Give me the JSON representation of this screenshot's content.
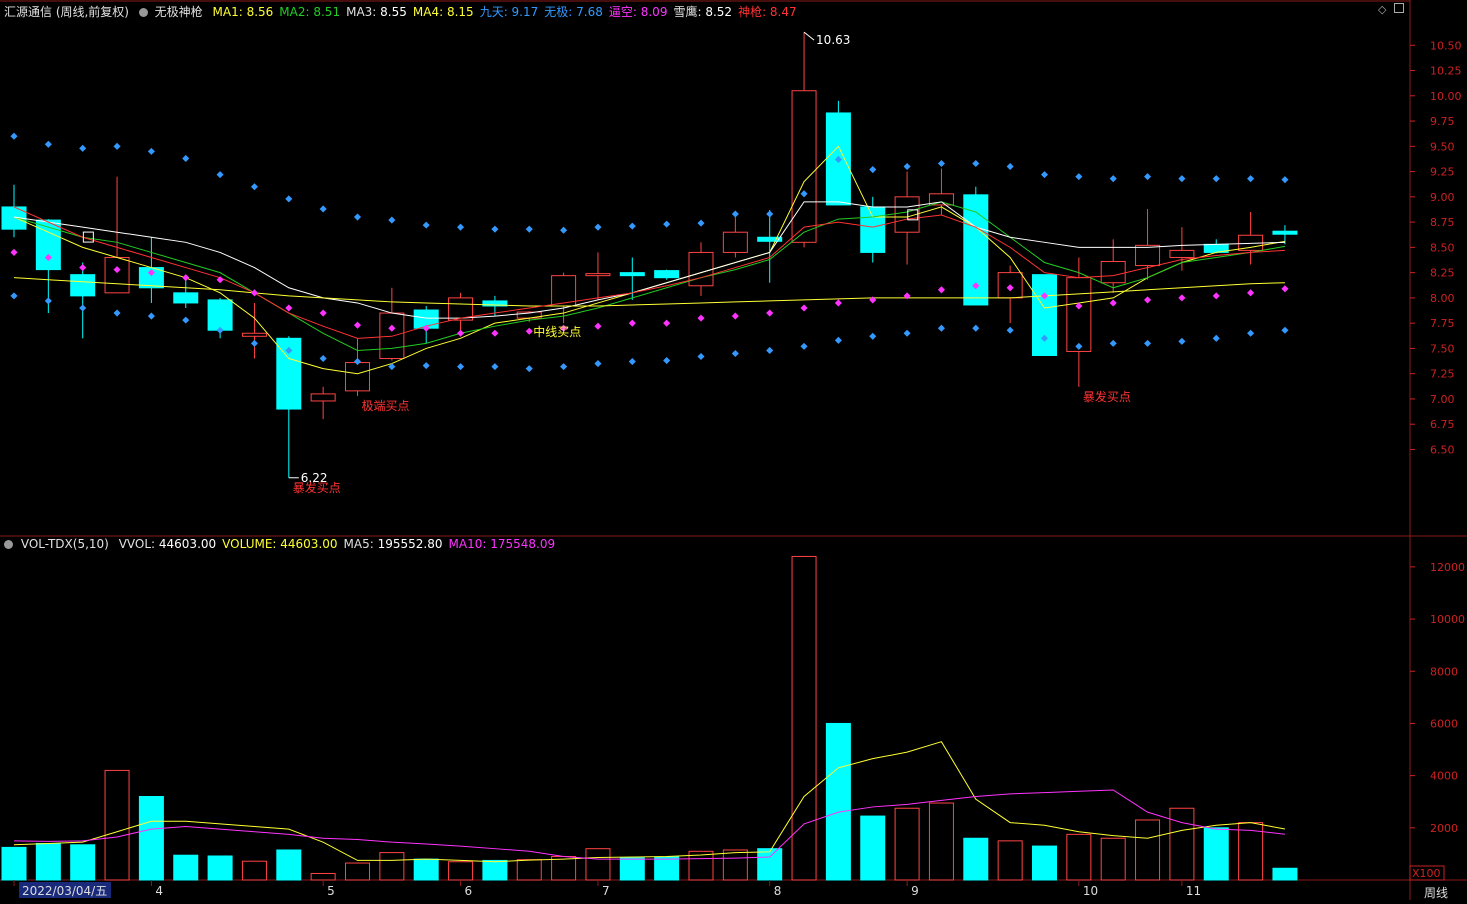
{
  "header": {
    "title": "汇源通信 (周线,前复权)",
    "indicator": "无极神枪",
    "items": [
      {
        "label": "MA1:",
        "value": "8.56",
        "color": "#ffff33"
      },
      {
        "label": "MA2:",
        "value": "8.51",
        "color": "#22cc22"
      },
      {
        "label": "MA3:",
        "value": "8.55",
        "color": "#ffffff"
      },
      {
        "label": "MA4:",
        "value": "8.15",
        "color": "#ffff33"
      },
      {
        "label": "九天:",
        "value": "9.17",
        "color": "#3399ff"
      },
      {
        "label": "无极:",
        "value": "7.68",
        "color": "#3399ff"
      },
      {
        "label": "逼空:",
        "value": "8.09",
        "color": "#ff33ff"
      },
      {
        "label": "雪鹰:",
        "value": "8.52",
        "color": "#ffffff"
      },
      {
        "label": "神枪:",
        "value": "8.47",
        "color": "#ff3333"
      }
    ]
  },
  "vol_header": {
    "name": "VOL-TDX(5,10)",
    "items": [
      {
        "label": "VVOL:",
        "value": "44603.00",
        "color": "#ffffff"
      },
      {
        "label": "VOLUME:",
        "value": "44603.00",
        "color": "#ffff33"
      },
      {
        "label": "MA5:",
        "value": "195552.80",
        "color": "#ffffff"
      },
      {
        "label": "MA10:",
        "value": "175548.09",
        "color": "#ff33ff"
      }
    ]
  },
  "colors": {
    "up": "#ff4444",
    "down": "#00ffff",
    "axis": "#8b1a1a",
    "tick": "#cc2222"
  },
  "chart_data": {
    "type": "candlestick",
    "price_axis": {
      "ticks": [
        "6.50",
        "6.75",
        "7.00",
        "7.25",
        "7.50",
        "7.75",
        "8.00",
        "8.25",
        "8.50",
        "8.75",
        "9.00",
        "9.25",
        "9.50",
        "9.75",
        "10.00",
        "10.25",
        "10.50"
      ],
      "range": [
        6.0,
        10.75
      ]
    },
    "vol_axis": {
      "ticks": [
        "2000",
        "4000",
        "6000",
        "8000",
        "10000",
        "12000"
      ],
      "unit": "X100",
      "range": [
        0,
        12800
      ]
    },
    "candles": [
      {
        "o": 8.9,
        "h": 9.12,
        "l": 8.6,
        "c": 8.68
      },
      {
        "o": 8.77,
        "h": 8.78,
        "l": 7.85,
        "c": 8.28
      },
      {
        "o": 8.23,
        "h": 8.35,
        "l": 7.6,
        "c": 8.02
      },
      {
        "o": 8.05,
        "h": 9.2,
        "l": 8.05,
        "c": 8.4
      },
      {
        "o": 8.3,
        "h": 8.6,
        "l": 7.95,
        "c": 8.1
      },
      {
        "o": 8.05,
        "h": 8.2,
        "l": 7.9,
        "c": 7.95
      },
      {
        "o": 7.98,
        "h": 8.0,
        "l": 7.6,
        "c": 7.68
      },
      {
        "o": 7.62,
        "h": 7.95,
        "l": 7.4,
        "c": 7.65
      },
      {
        "o": 7.6,
        "h": 7.62,
        "l": 6.22,
        "c": 6.9
      },
      {
        "o": 6.98,
        "h": 7.12,
        "l": 6.8,
        "c": 7.05
      },
      {
        "o": 7.08,
        "h": 7.6,
        "l": 7.03,
        "c": 7.36
      },
      {
        "o": 7.4,
        "h": 8.1,
        "l": 7.38,
        "c": 7.85
      },
      {
        "o": 7.88,
        "h": 7.92,
        "l": 7.55,
        "c": 7.7
      },
      {
        "o": 7.78,
        "h": 8.05,
        "l": 7.68,
        "c": 8.0
      },
      {
        "o": 7.97,
        "h": 8.02,
        "l": 7.82,
        "c": 7.92
      },
      {
        "o": 7.8,
        "h": 7.87,
        "l": 7.76,
        "c": 7.86
      },
      {
        "o": 7.92,
        "h": 8.25,
        "l": 7.75,
        "c": 8.22
      },
      {
        "o": 8.22,
        "h": 8.45,
        "l": 7.98,
        "c": 8.24
      },
      {
        "o": 8.25,
        "h": 8.4,
        "l": 7.98,
        "c": 8.22
      },
      {
        "o": 8.27,
        "h": 8.28,
        "l": 8.18,
        "c": 8.2
      },
      {
        "o": 8.12,
        "h": 8.55,
        "l": 8.02,
        "c": 8.45
      },
      {
        "o": 8.45,
        "h": 8.8,
        "l": 8.4,
        "c": 8.65
      },
      {
        "o": 8.6,
        "h": 8.87,
        "l": 8.15,
        "c": 8.56
      },
      {
        "o": 8.55,
        "h": 10.63,
        "l": 8.5,
        "c": 10.05
      },
      {
        "o": 9.83,
        "h": 9.95,
        "l": 8.95,
        "c": 8.92
      },
      {
        "o": 8.9,
        "h": 9.0,
        "l": 8.35,
        "c": 8.45
      },
      {
        "o": 8.65,
        "h": 9.25,
        "l": 8.33,
        "c": 9.0
      },
      {
        "o": 8.92,
        "h": 9.28,
        "l": 8.82,
        "c": 9.03
      },
      {
        "o": 9.02,
        "h": 9.1,
        "l": 7.95,
        "c": 7.93
      },
      {
        "o": 8.0,
        "h": 8.32,
        "l": 7.75,
        "c": 8.25
      },
      {
        "o": 8.23,
        "h": 8.23,
        "l": 7.43,
        "c": 7.43
      },
      {
        "o": 7.47,
        "h": 8.4,
        "l": 7.12,
        "c": 8.2
      },
      {
        "o": 8.15,
        "h": 8.58,
        "l": 8.05,
        "c": 8.36
      },
      {
        "o": 8.32,
        "h": 8.88,
        "l": 8.18,
        "c": 8.52
      },
      {
        "o": 8.4,
        "h": 8.7,
        "l": 8.27,
        "c": 8.47
      },
      {
        "o": 8.53,
        "h": 8.58,
        "l": 8.44,
        "c": 8.45
      },
      {
        "o": 8.47,
        "h": 8.85,
        "l": 8.33,
        "c": 8.62
      },
      {
        "o": 8.66,
        "h": 8.72,
        "l": 8.53,
        "c": 8.63
      }
    ],
    "volume": [
      1250,
      1400,
      1350,
      4200,
      3200,
      950,
      920,
      720,
      1150,
      250,
      650,
      1050,
      800,
      700,
      750,
      780,
      900,
      1200,
      850,
      880,
      1100,
      1150,
      1200,
      12400,
      6000,
      2450,
      2750,
      2950,
      1600,
      1500,
      1300,
      1750,
      1600,
      2300,
      2750,
      2000,
      2200,
      450
    ],
    "ma_lines": {
      "MA1": [
        8.8,
        8.65,
        8.5,
        8.4,
        8.3,
        8.2,
        8.05,
        7.8,
        7.4,
        7.3,
        7.25,
        7.35,
        7.5,
        7.6,
        7.75,
        7.8,
        7.85,
        7.95,
        8.05,
        8.15,
        8.25,
        8.35,
        8.45,
        9.15,
        9.5,
        8.8,
        8.8,
        8.9,
        8.7,
        8.4,
        7.9,
        7.95,
        8.0,
        8.2,
        8.35,
        8.45,
        8.5,
        8.56
      ],
      "MA2": [
        8.8,
        8.7,
        8.6,
        8.55,
        8.45,
        8.35,
        8.25,
        8.05,
        7.85,
        7.65,
        7.48,
        7.5,
        7.55,
        7.65,
        7.72,
        7.78,
        7.82,
        7.9,
        8.0,
        8.1,
        8.2,
        8.28,
        8.38,
        8.65,
        8.78,
        8.8,
        8.85,
        8.95,
        8.85,
        8.6,
        8.35,
        8.25,
        8.1,
        8.2,
        8.35,
        8.4,
        8.45,
        8.51
      ],
      "MA3": [
        8.8,
        8.75,
        8.7,
        8.65,
        8.6,
        8.55,
        8.45,
        8.3,
        8.1,
        8.0,
        7.95,
        7.85,
        7.8,
        7.8,
        7.82,
        7.85,
        7.9,
        7.98,
        8.05,
        8.15,
        8.25,
        8.35,
        8.45,
        8.95,
        8.95,
        8.9,
        8.9,
        8.95,
        8.7,
        8.6,
        8.55,
        8.5,
        8.5,
        8.5,
        8.52,
        8.53,
        8.54,
        8.55
      ],
      "MA4": [
        8.2,
        8.18,
        8.16,
        8.14,
        8.12,
        8.1,
        8.08,
        8.05,
        8.02,
        8.0,
        7.98,
        7.96,
        7.95,
        7.94,
        7.93,
        7.92,
        7.92,
        7.92,
        7.93,
        7.94,
        7.95,
        7.96,
        7.97,
        7.98,
        7.99,
        8.0,
        8.0,
        8.0,
        8.0,
        8.0,
        8.02,
        8.04,
        8.06,
        8.08,
        8.1,
        8.12,
        8.14,
        8.15
      ],
      "shenqiang": [
        8.9,
        8.75,
        8.6,
        8.5,
        8.4,
        8.3,
        8.2,
        8.05,
        7.85,
        7.72,
        7.6,
        7.62,
        7.72,
        7.8,
        7.85,
        7.9,
        7.95,
        8.0,
        8.05,
        8.12,
        8.2,
        8.3,
        8.4,
        8.7,
        8.75,
        8.7,
        8.78,
        8.82,
        8.7,
        8.5,
        8.25,
        8.2,
        8.22,
        8.3,
        8.38,
        8.42,
        8.45,
        8.47
      ]
    },
    "jiutian": [
      9.6,
      9.52,
      9.48,
      9.5,
      9.45,
      9.38,
      9.22,
      9.1,
      8.98,
      8.88,
      8.8,
      8.77,
      8.72,
      8.7,
      8.68,
      8.68,
      8.67,
      8.7,
      8.71,
      8.73,
      8.74,
      8.83,
      8.83,
      9.03,
      9.37,
      9.27,
      9.3,
      9.33,
      9.33,
      9.3,
      9.22,
      9.2,
      9.18,
      9.2,
      9.18,
      9.18,
      9.18,
      9.17
    ],
    "wuji": [
      8.02,
      7.97,
      7.9,
      7.85,
      7.82,
      7.78,
      7.68,
      7.55,
      7.48,
      7.4,
      7.37,
      7.32,
      7.33,
      7.32,
      7.32,
      7.3,
      7.32,
      7.35,
      7.37,
      7.38,
      7.42,
      7.45,
      7.48,
      7.52,
      7.58,
      7.62,
      7.65,
      7.7,
      7.7,
      7.68,
      7.6,
      7.52,
      7.55,
      7.55,
      7.57,
      7.6,
      7.65,
      7.68
    ],
    "bikong": [
      8.45,
      8.4,
      8.3,
      8.28,
      8.25,
      8.2,
      8.18,
      8.05,
      7.9,
      7.85,
      7.73,
      7.7,
      7.7,
      7.65,
      7.65,
      7.67,
      7.7,
      7.72,
      7.75,
      7.75,
      7.8,
      7.82,
      7.85,
      7.9,
      7.95,
      7.98,
      8.02,
      8.08,
      8.12,
      8.1,
      8.02,
      7.92,
      7.95,
      7.98,
      8.0,
      8.02,
      8.05,
      8.09
    ],
    "vol_ma5": [
      1350,
      1400,
      1450,
      1850,
      2250,
      2250,
      2150,
      2050,
      1950,
      1450,
      750,
      750,
      800,
      750,
      700,
      760,
      800,
      860,
      880,
      900,
      960,
      1050,
      1080,
      3200,
      4300,
      4650,
      4900,
      5300,
      3100,
      2200,
      2100,
      1850,
      1700,
      1600,
      1900,
      2100,
      2200,
      1955
    ],
    "vol_ma10": [
      1500,
      1480,
      1500,
      1650,
      1950,
      2050,
      1950,
      1850,
      1750,
      1600,
      1550,
      1450,
      1380,
      1300,
      1200,
      1100,
      900,
      800,
      800,
      800,
      820,
      840,
      880,
      2150,
      2600,
      2800,
      2900,
      3050,
      3200,
      3300,
      3350,
      3400,
      3450,
      2600,
      2200,
      1950,
      1900,
      1755
    ],
    "signals": [
      {
        "i": 8,
        "text": "暴发买点",
        "color": "#ff3333"
      },
      {
        "i": 10,
        "text": "极端买点",
        "color": "#ff3333"
      },
      {
        "i": 15,
        "text": "中线买点",
        "color": "#ffff33"
      },
      {
        "i": 31,
        "text": "暴发买点",
        "color": "#ff3333"
      }
    ],
    "sell_marks": [
      1,
      25
    ],
    "peak_label": {
      "i": 23,
      "text": "10.63"
    },
    "low_label": {
      "i": 8,
      "text": "6.22"
    },
    "x_labels": [
      {
        "i": 0,
        "text": "2022/03/04/五",
        "highlight": true
      },
      {
        "i": 4,
        "text": "4"
      },
      {
        "i": 9,
        "text": "5"
      },
      {
        "i": 13,
        "text": "6"
      },
      {
        "i": 17,
        "text": "7"
      },
      {
        "i": 22,
        "text": "8"
      },
      {
        "i": 26,
        "text": "9"
      },
      {
        "i": 31,
        "text": "10"
      },
      {
        "i": 34,
        "text": "11"
      }
    ]
  },
  "footer": {
    "period": "周线"
  }
}
